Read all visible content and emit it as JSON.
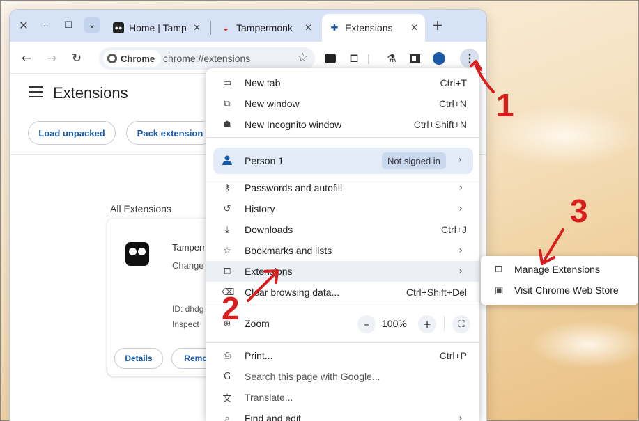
{
  "tabs": [
    {
      "title": "Home | Tamp",
      "active": false
    },
    {
      "title": "Tampermonk",
      "active": false
    },
    {
      "title": "Extensions",
      "active": true
    }
  ],
  "window_controls": {
    "close": "✕",
    "minimize": "–",
    "maximize": "☐",
    "dropdown": "⌄"
  },
  "new_tab_label": "+",
  "toolbar": {
    "chip_label": "Chrome",
    "url": "chrome://extensions"
  },
  "page": {
    "title": "Extensions",
    "buttons": [
      "Load unpacked",
      "Pack extension"
    ],
    "section_label": "All Extensions",
    "card": {
      "name": "Tamperr",
      "description": "Change",
      "id_text": "ID: dhdg",
      "inspect_text": "Inspect",
      "details_label": "Details",
      "remove_label": "Remo"
    }
  },
  "menu": {
    "top_items": [
      {
        "icon": "new-tab-icon",
        "glyph": "▭",
        "label": "New tab",
        "shortcut": "Ctrl+T"
      },
      {
        "icon": "new-window-icon",
        "glyph": "⧉",
        "label": "New window",
        "shortcut": "Ctrl+N"
      },
      {
        "icon": "incognito-icon",
        "glyph": "☗",
        "label": "New Incognito window",
        "shortcut": "Ctrl+Shift+N"
      }
    ],
    "person": {
      "label": "Person 1",
      "badge": "Not signed in"
    },
    "items": [
      {
        "icon": "key-icon",
        "glyph": "⚷",
        "label": "Passwords and autofill",
        "shortcut": "",
        "arrow": true
      },
      {
        "icon": "history-icon",
        "glyph": "↺",
        "label": "History",
        "shortcut": "",
        "arrow": true
      },
      {
        "icon": "download-icon",
        "glyph": "⤓",
        "label": "Downloads",
        "shortcut": "Ctrl+J",
        "arrow": false
      },
      {
        "icon": "star-icon",
        "glyph": "☆",
        "label": "Bookmarks and lists",
        "shortcut": "",
        "arrow": true
      },
      {
        "icon": "puzzle-icon",
        "glyph": "⧠",
        "label": "Extensions",
        "shortcut": "",
        "arrow": true
      },
      {
        "icon": "trash-icon",
        "glyph": "⌫",
        "label": "Clear browsing data...",
        "shortcut": "Ctrl+Shift+Del",
        "arrow": false
      }
    ],
    "zoom": {
      "label": "Zoom",
      "value": "100%",
      "minus": "–",
      "plus": "+",
      "fullscreen": "⛶"
    },
    "bottom_items": [
      {
        "icon": "print-icon",
        "glyph": "⎙",
        "label": "Print...",
        "shortcut": "Ctrl+P",
        "arrow": false,
        "dim": false
      },
      {
        "icon": "google-icon",
        "glyph": "G",
        "label": "Search this page with Google...",
        "shortcut": "",
        "arrow": false,
        "dim": true
      },
      {
        "icon": "translate-icon",
        "glyph": "文",
        "label": "Translate...",
        "shortcut": "",
        "arrow": false,
        "dim": true
      },
      {
        "icon": "find-icon",
        "glyph": "⌕",
        "label": "Find and edit",
        "shortcut": "",
        "arrow": true,
        "dim": false
      }
    ]
  },
  "submenu": {
    "items": [
      {
        "icon": "puzzle-icon",
        "glyph": "⧠",
        "label": "Manage Extensions"
      },
      {
        "icon": "store-icon",
        "glyph": "▣",
        "label": "Visit Chrome Web Store"
      }
    ]
  },
  "annotations": {
    "step1": "1",
    "step2": "2",
    "step3": "3",
    "color": "#d81d1d"
  }
}
